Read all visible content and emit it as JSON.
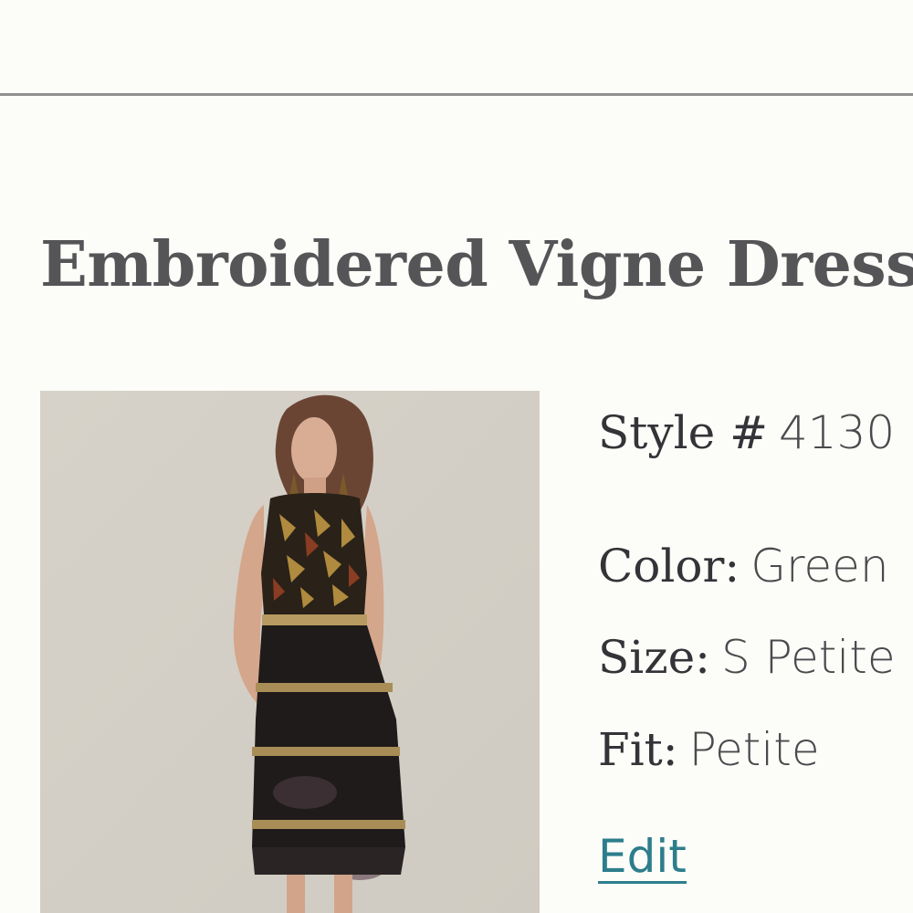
{
  "product": {
    "title": "Embroidered Vigne Dress",
    "image_alt": "Model wearing embroidered dress"
  },
  "details": {
    "style_label": "Style #",
    "style_value": "4130",
    "color_label": "Color:",
    "color_value": "Green",
    "size_label": "Size:",
    "size_value": "S Petite",
    "fit_label": "Fit:",
    "fit_value": "Petite",
    "edit_label": "Edit"
  },
  "colors": {
    "link": "#2d7e8c",
    "title": "#555558",
    "divider": "#8f8f8f"
  }
}
